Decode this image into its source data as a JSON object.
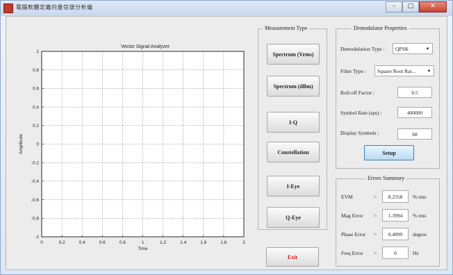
{
  "window": {
    "title": "電腦軟體定義向量信號分析儀",
    "close_glyph": "✕",
    "min_glyph": "–",
    "max_glyph": "□"
  },
  "plot": {
    "title": "Vector Signal Analyzer",
    "xlabel": "Time",
    "ylabel": "Amplitude",
    "xticks": [
      "0",
      "0.2",
      "0.4",
      "0.6",
      "0.8",
      "1",
      "1.2",
      "1.4",
      "1.6",
      "1.8",
      "2"
    ],
    "yticks": [
      "1",
      "0.8",
      "0.6",
      "0.4",
      "0.2",
      "0",
      "-0.2",
      "-0.4",
      "-0.6",
      "-0.8",
      "-1"
    ]
  },
  "chart_data": {
    "type": "line",
    "title": "Vector Signal Analyzer",
    "xlabel": "Time",
    "ylabel": "Amplitude",
    "xlim": [
      0,
      2
    ],
    "ylim": [
      -1,
      1
    ],
    "grid": true,
    "series": []
  },
  "measurement": {
    "title": "Measurement Type",
    "buttons": [
      "Spectrum (Vrms)",
      "Spectrum (dBm)",
      "I-Q",
      "Constellation",
      "I-Eye",
      "Q-Eye"
    ]
  },
  "exit_label": "Exit",
  "demod": {
    "title": "Demodulator Properties",
    "modulation_type_label": "Demodulation Type :",
    "modulation_type_value": "QPSK",
    "filter_type_label": "Filter Type :",
    "filter_type_value": "Square Root Rai...",
    "rolloff_label": "Roll-off Factor :",
    "rolloff_value": "0.5",
    "symbol_rate_label": "Symbol Rate (sps) :",
    "symbol_rate_value": "400000",
    "display_symbols_label": "Display Symbols :",
    "display_symbols_value": "68",
    "setup_label": "Setup"
  },
  "errors": {
    "title": "Errors Summary",
    "rows": [
      {
        "label": "EVM",
        "eq": "=",
        "value": "8.2358",
        "unit": "% rms"
      },
      {
        "label": "Mag Error",
        "eq": "=",
        "value": "1.3994",
        "unit": "% rms"
      },
      {
        "label": "Phase Error",
        "eq": "=",
        "value": "0.4899",
        "unit": "degree"
      },
      {
        "label": "Freq Error",
        "eq": "=",
        "value": "0",
        "unit": "Hz"
      }
    ]
  }
}
